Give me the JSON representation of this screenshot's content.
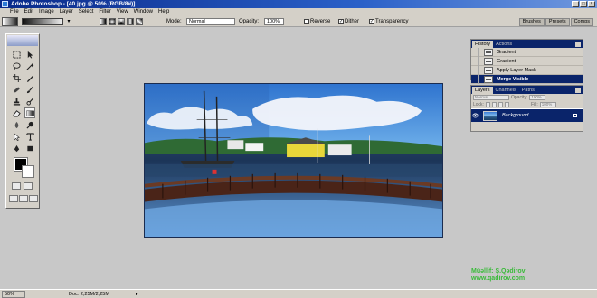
{
  "window": {
    "title": "Adobe Photoshop - [40.jpg @ 50% (RGB/8#)]",
    "controls": [
      "_",
      "□",
      "×"
    ]
  },
  "menu": [
    "File",
    "Edit",
    "Image",
    "Layer",
    "Select",
    "Filter",
    "View",
    "Window",
    "Help"
  ],
  "options": {
    "mode_label": "Mode:",
    "mode_value": "Normal",
    "opacity_label": "Opacity:",
    "opacity_value": "100%",
    "reverse_label": "Reverse",
    "dither_label": "Dither",
    "transparency_label": "Transparency",
    "dither_checked": true,
    "transparency_checked": true
  },
  "palette_wells": [
    "Brushes",
    "Presets",
    "Comps"
  ],
  "history": {
    "tabs": [
      "History",
      "Actions"
    ],
    "items": [
      "Gradient",
      "Gradient",
      "Apply Layer Mask",
      "Merge Visible"
    ]
  },
  "layers": {
    "tabs": [
      "Layers",
      "Channels",
      "Paths"
    ],
    "blend_mode": "Normal",
    "opacity_label": "Opacity:",
    "opacity_value": "100%",
    "lock_label": "Lock:",
    "fill_label": "Fill:",
    "fill_value": "100%",
    "layer_name": "Background"
  },
  "watermark": {
    "line1": "Müəllif: Ş.Qədirov",
    "line2": "www.qadirov.com"
  },
  "status": {
    "zoom": "50%",
    "doc": "Doc: 2,25M/2,25M"
  },
  "colors": {
    "foreground": "#000000",
    "background": "#ffffff",
    "highlight": "#0a246a"
  }
}
